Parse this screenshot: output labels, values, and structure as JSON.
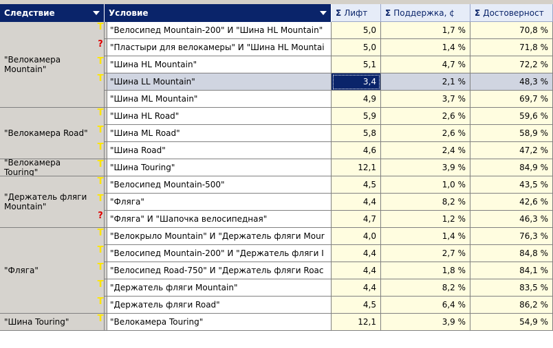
{
  "headers": {
    "consequent": "Следствие",
    "condition": "Условие",
    "lift": "Лифт",
    "support": "Поддержка, ¢",
    "confidence": "Достоверност",
    "sigma": "Σ"
  },
  "groups": [
    {
      "label": "\"Велокамера Mountain\"",
      "rows": [
        0,
        1,
        2,
        3,
        4
      ]
    },
    {
      "label": "\"Велокамера Road\"",
      "rows": [
        5,
        6,
        7
      ]
    },
    {
      "label": "\"Велокамера Touring\"",
      "rows": [
        8
      ]
    },
    {
      "label": "\"Держатель фляги Mountain\"",
      "rows": [
        9,
        10,
        11
      ]
    },
    {
      "label": "\"Фляга\"",
      "rows": [
        12,
        13,
        14,
        15,
        16
      ]
    },
    {
      "label": "\"Шина Touring\"",
      "rows": [
        17
      ]
    }
  ],
  "rows": [
    {
      "icon": "T",
      "condition": "\"Велосипед Mountain-200\" И \"Шина HL Mountain\"",
      "lift": "5,0",
      "support": "1,7 %",
      "confidence": "70,8 %"
    },
    {
      "icon": "?",
      "condition": "\"Пластыри для велокамеры\" И \"Шина HL Mountai",
      "lift": "5,0",
      "support": "1,4 %",
      "confidence": "71,8 %"
    },
    {
      "icon": "T",
      "condition": "\"Шина HL Mountain\"",
      "lift": "5,1",
      "support": "4,7 %",
      "confidence": "72,2 %"
    },
    {
      "icon": "T",
      "condition": "\"Шина LL Mountain\"",
      "lift": "3,4",
      "support": "2,1 %",
      "confidence": "48,3 %",
      "selected": true
    },
    {
      "icon": "",
      "condition": "\"Шина ML Mountain\"",
      "lift": "4,9",
      "support": "3,7 %",
      "confidence": "69,7 %"
    },
    {
      "icon": "T",
      "condition": "\"Шина HL Road\"",
      "lift": "5,9",
      "support": "2,6 %",
      "confidence": "59,6 %"
    },
    {
      "icon": "T",
      "condition": "\"Шина ML Road\"",
      "lift": "5,8",
      "support": "2,6 %",
      "confidence": "58,9 %"
    },
    {
      "icon": "T",
      "condition": "\"Шина Road\"",
      "lift": "4,6",
      "support": "2,4 %",
      "confidence": "47,2 %"
    },
    {
      "icon": "T",
      "condition": "\"Шина Touring\"",
      "lift": "12,1",
      "support": "3,9 %",
      "confidence": "84,9 %"
    },
    {
      "icon": "T",
      "condition": "\"Велосипед Mountain-500\"",
      "lift": "4,5",
      "support": "1,0 %",
      "confidence": "43,5 %"
    },
    {
      "icon": "T",
      "condition": "\"Фляга\"",
      "lift": "4,4",
      "support": "8,2 %",
      "confidence": "42,6 %"
    },
    {
      "icon": "?",
      "condition": "\"Фляга\" И \"Шапочка велосипедная\"",
      "lift": "4,7",
      "support": "1,2 %",
      "confidence": "46,3 %"
    },
    {
      "icon": "T",
      "condition": "\"Велокрыло Mountain\" И \"Держатель фляги Mour",
      "lift": "4,0",
      "support": "1,4 %",
      "confidence": "76,3 %"
    },
    {
      "icon": "T",
      "condition": "\"Велосипед Mountain-200\" И \"Держатель фляги I",
      "lift": "4,4",
      "support": "2,7 %",
      "confidence": "84,8 %"
    },
    {
      "icon": "T",
      "condition": "\"Велосипед Road-750\" И \"Держатель фляги Roac",
      "lift": "4,4",
      "support": "1,8 %",
      "confidence": "84,1 %"
    },
    {
      "icon": "T",
      "condition": "\"Держатель фляги Mountain\"",
      "lift": "4,4",
      "support": "8,2 %",
      "confidence": "83,5 %"
    },
    {
      "icon": "T",
      "condition": "\"Держатель фляги Road\"",
      "lift": "4,5",
      "support": "6,4 %",
      "confidence": "86,2 %"
    },
    {
      "icon": "T",
      "condition": "\"Велокамера Touring\"",
      "lift": "12,1",
      "support": "3,9 %",
      "confidence": "54,9 %"
    }
  ]
}
